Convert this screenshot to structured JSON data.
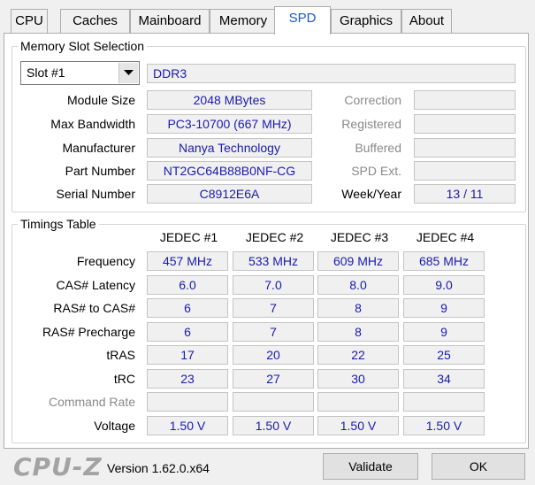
{
  "tabs": [
    "CPU",
    "Caches",
    "Mainboard",
    "Memory",
    "SPD",
    "Graphics",
    "About"
  ],
  "active_tab": "SPD",
  "slot_section": {
    "legend": "Memory Slot Selection",
    "slot_selected": "Slot #1",
    "memory_type": "DDR3",
    "labels": {
      "module_size": "Module Size",
      "max_bandwidth": "Max Bandwidth",
      "manufacturer": "Manufacturer",
      "part_number": "Part Number",
      "serial_number": "Serial Number",
      "correction": "Correction",
      "registered": "Registered",
      "buffered": "Buffered",
      "spd_ext": "SPD Ext.",
      "week_year": "Week/Year"
    },
    "values": {
      "module_size": "2048 MBytes",
      "max_bandwidth": "PC3-10700 (667 MHz)",
      "manufacturer": "Nanya Technology",
      "part_number": "NT2GC64B88B0NF-CG",
      "serial_number": "C8912E6A",
      "correction": "",
      "registered": "",
      "buffered": "",
      "spd_ext": "",
      "week_year": "13 / 11"
    }
  },
  "timings": {
    "legend": "Timings Table",
    "columns": [
      "JEDEC #1",
      "JEDEC #2",
      "JEDEC #3",
      "JEDEC #4"
    ],
    "rows": [
      {
        "label": "Frequency",
        "dim": false,
        "values": [
          "457 MHz",
          "533 MHz",
          "609 MHz",
          "685 MHz"
        ]
      },
      {
        "label": "CAS# Latency",
        "dim": false,
        "values": [
          "6.0",
          "7.0",
          "8.0",
          "9.0"
        ]
      },
      {
        "label": "RAS# to CAS#",
        "dim": false,
        "values": [
          "6",
          "7",
          "8",
          "9"
        ]
      },
      {
        "label": "RAS# Precharge",
        "dim": false,
        "values": [
          "6",
          "7",
          "8",
          "9"
        ]
      },
      {
        "label": "tRAS",
        "dim": false,
        "values": [
          "17",
          "20",
          "22",
          "25"
        ]
      },
      {
        "label": "tRC",
        "dim": false,
        "values": [
          "23",
          "27",
          "30",
          "34"
        ]
      },
      {
        "label": "Command Rate",
        "dim": true,
        "values": [
          "",
          "",
          "",
          ""
        ]
      },
      {
        "label": "Voltage",
        "dim": false,
        "values": [
          "1.50 V",
          "1.50 V",
          "1.50 V",
          "1.50 V"
        ]
      }
    ]
  },
  "footer": {
    "logo": "CPU-Z",
    "version": "Version 1.62.0.x64",
    "validate_label": "Validate",
    "ok_label": "OK"
  },
  "colors": {
    "value_text": "#1a1ab0",
    "active_tab_text": "#1c5ac9",
    "window_bg": "#f0f0f0",
    "panel_bg": "#ffffff"
  }
}
